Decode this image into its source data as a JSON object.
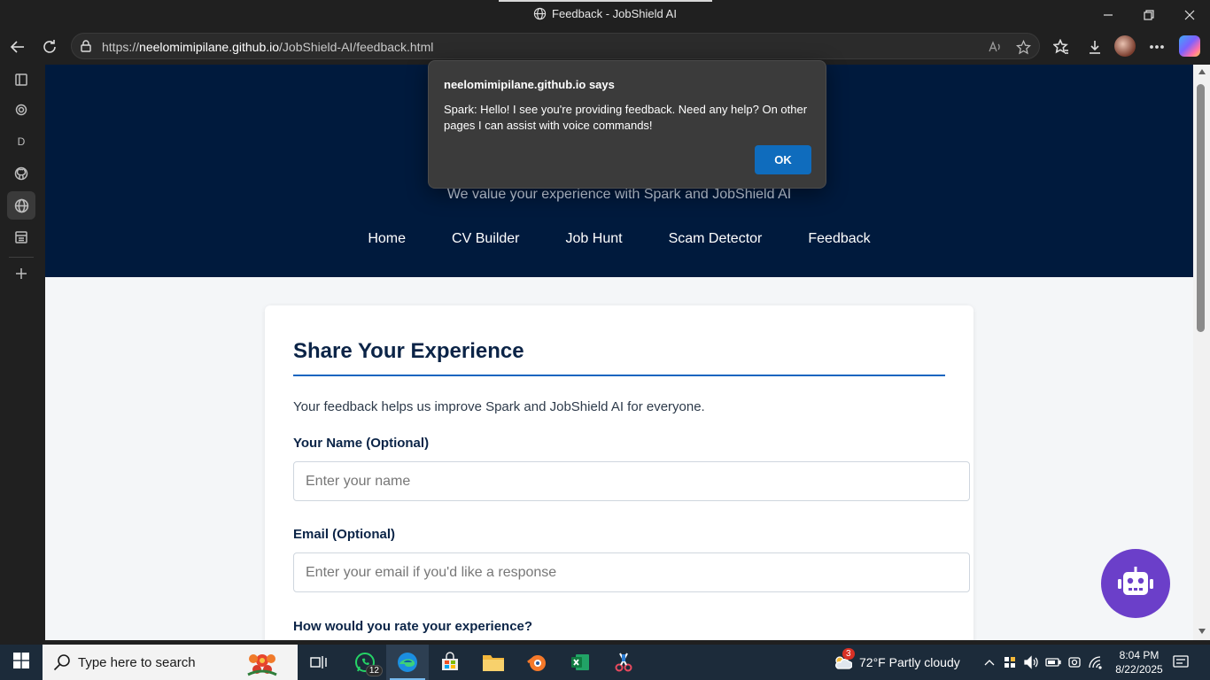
{
  "window": {
    "title": "Feedback - JobShield AI"
  },
  "browser": {
    "url_prefix": "https://",
    "url_host": "neelomimipilane.github.io",
    "url_path": "/JobShield-AI/feedback.html",
    "sidebar_d_label": "D"
  },
  "dialog": {
    "title": "neelomimipilane.github.io says",
    "message": "Spark: Hello! I see you're providing feedback. Need any help? On other pages I can assist with voice commands!",
    "ok_label": "OK"
  },
  "site": {
    "subtitle": "We value your experience with Spark and JobShield AI",
    "nav": [
      "Home",
      "CV Builder",
      "Job Hunt",
      "Scam Detector",
      "Feedback"
    ]
  },
  "form": {
    "heading": "Share Your Experience",
    "intro": "Your feedback helps us improve Spark and JobShield AI for everyone.",
    "name_label": "Your Name (Optional)",
    "name_placeholder": "Enter your name",
    "email_label": "Email (Optional)",
    "email_placeholder": "Enter your email if you'd like a response",
    "rating_label": "How would you rate your experience?"
  },
  "taskbar": {
    "search_placeholder": "Type here to search",
    "whatsapp_badge": "12",
    "weather_badge": "3",
    "weather": "72°F  Partly cloudy",
    "time": "8:04 PM",
    "date": "8/22/2025"
  },
  "colors": {
    "header_bg": "#001a3d",
    "accent_blue": "#1565c0",
    "robot_purple": "#6b3fc9",
    "ok_button": "#0f6cbd"
  }
}
